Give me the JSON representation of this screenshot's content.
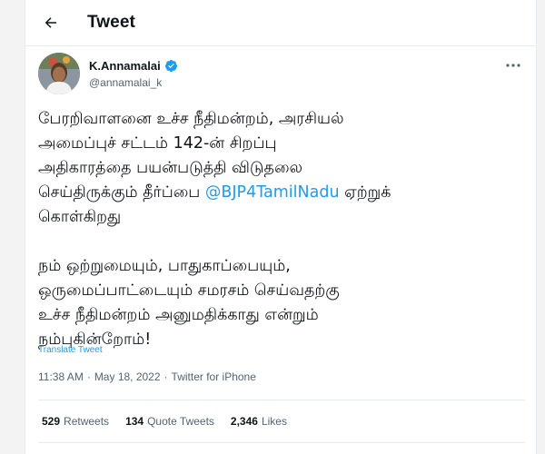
{
  "header": {
    "title": "Tweet",
    "back_icon": "arrow-left-icon"
  },
  "author": {
    "name": "K.Annamalai",
    "handle": "@annamalai_k",
    "verified": true,
    "verified_icon": "verified-badge-icon",
    "more_icon": "more-horizontal-icon"
  },
  "tweet": {
    "paragraph1_lines": [
      "பேரறிவாளனை உச்ச நீதிமன்றம், அரசியல்",
      "அமைப்புச் சட்டம் 142-ன் சிறப்பு",
      "அதிகாரத்தை பயன்படுத்தி விடுதலை"
    ],
    "line4_before": "செய்திருக்கும் தீர்ப்பை ",
    "mention": "@BJP4TamilNadu",
    "line4_after": " ஏற்றுக்",
    "line5": "கொள்கிறது",
    "paragraph2_lines": [
      "நம் ஒற்றுமையும், பாதுகாப்பையும்,",
      "ஒருமைப்பாட்டையும் சமரசம் செய்வதற்கு",
      "உச்ச நீதிமன்றம் அனுமதிக்காது என்றும்",
      "நம்புகின்றோம்!"
    ],
    "translate_label": "Translate Tweet"
  },
  "meta": {
    "time": "11:38 AM",
    "date": "May 18, 2022",
    "separator": "·",
    "source": "Twitter for iPhone"
  },
  "stats": {
    "retweets_count": "529",
    "retweets_label": "Retweets",
    "quote_count": "134",
    "quote_label": "Quote Tweets",
    "likes_count": "2,346",
    "likes_label": "Likes"
  },
  "colors": {
    "link": "#1d9bf0",
    "text": "#0f1419",
    "secondary": "#536471",
    "border": "#e6ecf0"
  }
}
